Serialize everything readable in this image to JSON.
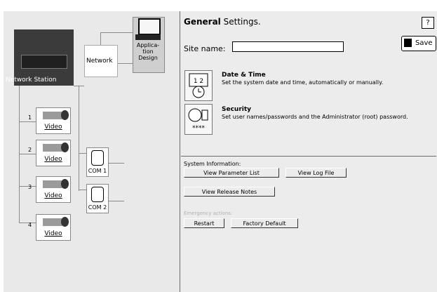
{
  "colors": {
    "panel_bg": "#ececec",
    "tree_bg": "#e9e9e9",
    "station_bg": "#3b3b3b",
    "emergency_text": "#b0b0b0"
  },
  "tree": {
    "network_station_label": "Network Station",
    "network_label": "Network",
    "application_design_label": "Applica-\ntion\nDesign",
    "video": [
      {
        "number": "1",
        "label": "Video"
      },
      {
        "number": "2",
        "label": "Video"
      },
      {
        "number": "3",
        "label": "Video"
      },
      {
        "number": "4",
        "label": "Video"
      }
    ],
    "com": [
      {
        "label": "COM 1"
      },
      {
        "label": "COM 2"
      }
    ]
  },
  "header": {
    "title_bold": "General",
    "title_rest": "Settings.",
    "help_label": "?",
    "save_label": "Save"
  },
  "site": {
    "label": "Site name:",
    "value": ""
  },
  "items": [
    {
      "title": "Date & Time",
      "description": "Set the system date and time, automatically or manually.",
      "icon": "clock-calendar-icon"
    },
    {
      "title": "Security",
      "description": "Set user names/passwords and the Administrator (root) password.",
      "icon": "lock-password-icon"
    }
  ],
  "system_info": {
    "label": "System Information:",
    "view_parameter_list": "View Parameter List",
    "view_log_file": "View Log File",
    "view_release_notes": "View Release Notes"
  },
  "emergency": {
    "label": "Emergency actions:",
    "restart": "Restart",
    "factory_default": "Factory Default"
  }
}
